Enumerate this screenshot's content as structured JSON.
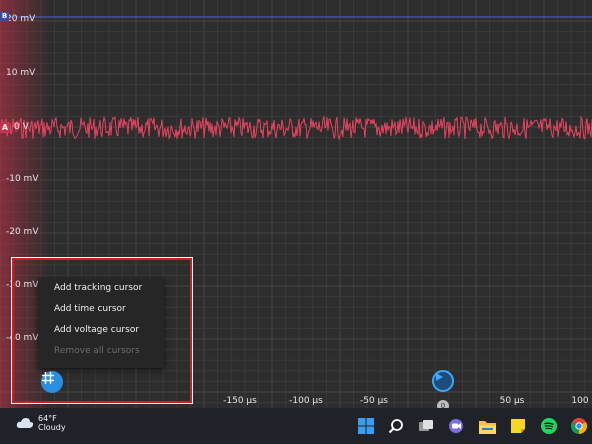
{
  "oscilloscope": {
    "y_axis_labels": [
      "20 mV",
      "10 mV",
      "0 V",
      "-10 mV",
      "-20 mV",
      "-30 mV",
      "-40 mV"
    ],
    "x_axis_labels": [
      "-150 µs",
      "-100 µs",
      "-50 µs",
      "0",
      "50 µs",
      "100"
    ],
    "channel_a_tag": "A",
    "channel_b_tag": "B",
    "trace_color": "#e8435f",
    "trigger_marker": "0"
  },
  "context_menu": {
    "items": [
      {
        "label": "Add tracking cursor",
        "enabled": true
      },
      {
        "label": "Add time cursor",
        "enabled": true
      },
      {
        "label": "Add voltage cursor",
        "enabled": true
      },
      {
        "label": "Remove all cursors",
        "enabled": false
      }
    ]
  },
  "taskbar": {
    "weather_temp": "64°F",
    "weather_desc": "Cloudy",
    "icons": [
      "windows-start-icon",
      "search-icon",
      "task-view-icon",
      "chat-icon",
      "file-explorer-icon",
      "sticky-notes-icon",
      "spotify-icon",
      "chrome-icon"
    ]
  }
}
